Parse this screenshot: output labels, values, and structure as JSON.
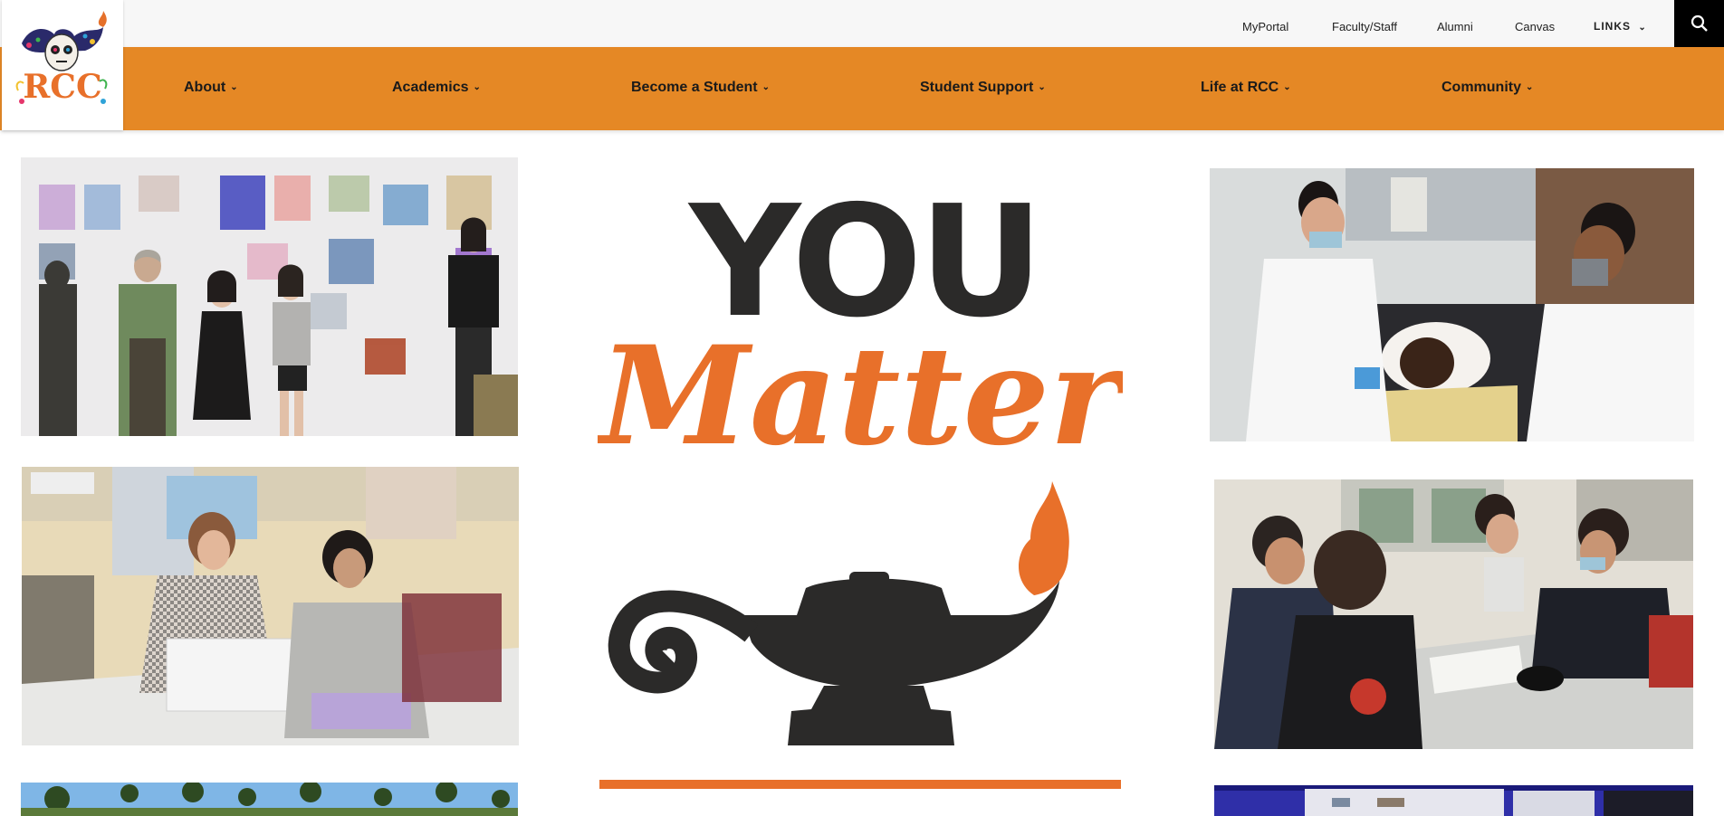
{
  "utility_links": [
    {
      "label": "MyPortal"
    },
    {
      "label": "Faculty/Staff"
    },
    {
      "label": "Alumni"
    },
    {
      "label": "Canvas"
    }
  ],
  "links_menu": {
    "label": "LINKS",
    "icon": "chevron-down-icon"
  },
  "search": {
    "icon": "search-icon"
  },
  "logo": {
    "text": "RCC"
  },
  "nav": [
    {
      "label": "About"
    },
    {
      "label": "Academics"
    },
    {
      "label": "Become a Student"
    },
    {
      "label": "Student Support"
    },
    {
      "label": "Life at RCC"
    },
    {
      "label": "Community"
    }
  ],
  "hero": {
    "line1": "YOU",
    "line2": "Matter"
  },
  "colors": {
    "orange": "#e58825",
    "accent_orange": "#e8702a",
    "dark": "#2b2a29"
  }
}
